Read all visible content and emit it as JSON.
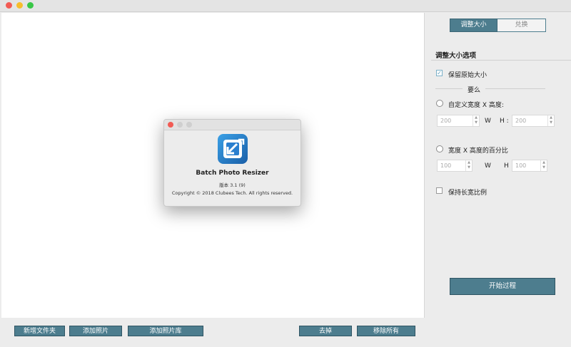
{
  "window": {
    "title": ""
  },
  "toolbar": {
    "new_folder": "新增文件夹",
    "add_photos": "添加照片",
    "add_library": "添加照片库",
    "remove": "去掉",
    "remove_all": "移除所有"
  },
  "tabs": {
    "resize": "调整大小",
    "convert": "兑换"
  },
  "options": {
    "section_title": "调整大小选项",
    "keep_original": "保留原始大小",
    "keep_original_checked": true,
    "or_label": "要么",
    "custom_wh": "自定义宽度 X 高度:",
    "w_label": "W",
    "h_label": "H :",
    "width_placeholder": "200",
    "height_placeholder": "200",
    "percent_label": "宽度 X 高度的百分比",
    "w_label2": "W",
    "h_label2": "H",
    "width_percent_placeholder": "100",
    "height_percent_placeholder": "100",
    "keep_ratio": "保持长宽比例",
    "keep_ratio_checked": false
  },
  "start_button": "开始过程",
  "about_dialog": {
    "app_name": "Batch Photo Resizer",
    "version": "版本 3.1 (9)",
    "copyright": "Copyright © 2018 Clubees Tech. All rights reserved."
  },
  "colors": {
    "accent": "#4d7d8e",
    "accent_border": "#2f5564"
  }
}
